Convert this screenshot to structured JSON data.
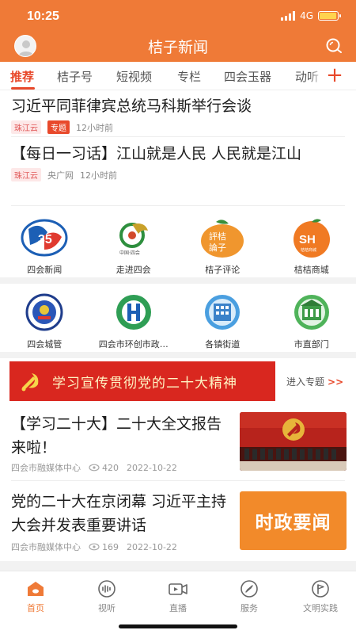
{
  "status": {
    "time": "10:25",
    "network": "4G",
    "battery_level": 0.95
  },
  "header": {
    "title": "桔子新闻",
    "avatar_icon": "user-avatar-icon",
    "search_icon": "search-icon"
  },
  "tabs": [
    {
      "label": "推荐",
      "active": true
    },
    {
      "label": "桔子号"
    },
    {
      "label": "短视频"
    },
    {
      "label": "专栏"
    },
    {
      "label": "四会玉器"
    },
    {
      "label": "动听"
    }
  ],
  "tab_more": "+",
  "top_news": [
    {
      "title": "习近平同菲律宾总统马科斯举行会谈",
      "tag": "珠江云",
      "tag2": "专题",
      "time": "12小时前"
    },
    {
      "title": "【每日一习话】江山就是人民 人民就是江山",
      "tag": "珠江云",
      "source": "央广网",
      "time": "12小时前"
    }
  ],
  "grid_row1": [
    {
      "label": "四会新闻",
      "icon": "sihui-news-logo-icon"
    },
    {
      "label": "走进四会",
      "icon": "visit-sihui-logo-icon"
    },
    {
      "label": "桔子评论",
      "icon": "orange-comment-logo-icon"
    },
    {
      "label": "桔桔商城",
      "icon": "orange-mall-logo-icon"
    }
  ],
  "grid_row2": [
    {
      "label": "四会城管",
      "icon": "city-management-emblem-icon"
    },
    {
      "label": "四会市环创市政…",
      "icon": "environment-logo-icon"
    },
    {
      "label": "各镇街道",
      "icon": "town-building-icon"
    },
    {
      "label": "市直部门",
      "icon": "department-building-icon"
    }
  ],
  "banner": {
    "text": "学习宣传贯彻党的二十大精神",
    "enter": "进入专题",
    "arrow": ">>",
    "emblem_icon": "party-emblem-icon"
  },
  "articles": [
    {
      "title": "【学习二十大】二十大全文报告来啦！",
      "source": "四会市融媒体中心",
      "views": "420",
      "date": "2022-10-22",
      "thumb_icon": "congress-photo-image"
    },
    {
      "title": "党的二十大在京闭幕 习近平主持大会并发表重要讲话",
      "source": "四会市融媒体中心",
      "views": "169",
      "date": "2022-10-22",
      "thumb_text": "时政要闻"
    }
  ],
  "bottom_nav": [
    {
      "label": "首页",
      "icon": "home-icon",
      "active": true
    },
    {
      "label": "视听",
      "icon": "audio-icon"
    },
    {
      "label": "直播",
      "icon": "live-video-icon"
    },
    {
      "label": "服务",
      "icon": "compass-icon"
    },
    {
      "label": "文明实践",
      "icon": "flag-badge-icon"
    }
  ],
  "colors": {
    "brand": "#ef7a37",
    "accent": "#e8492b",
    "banner": "#d9271f"
  }
}
